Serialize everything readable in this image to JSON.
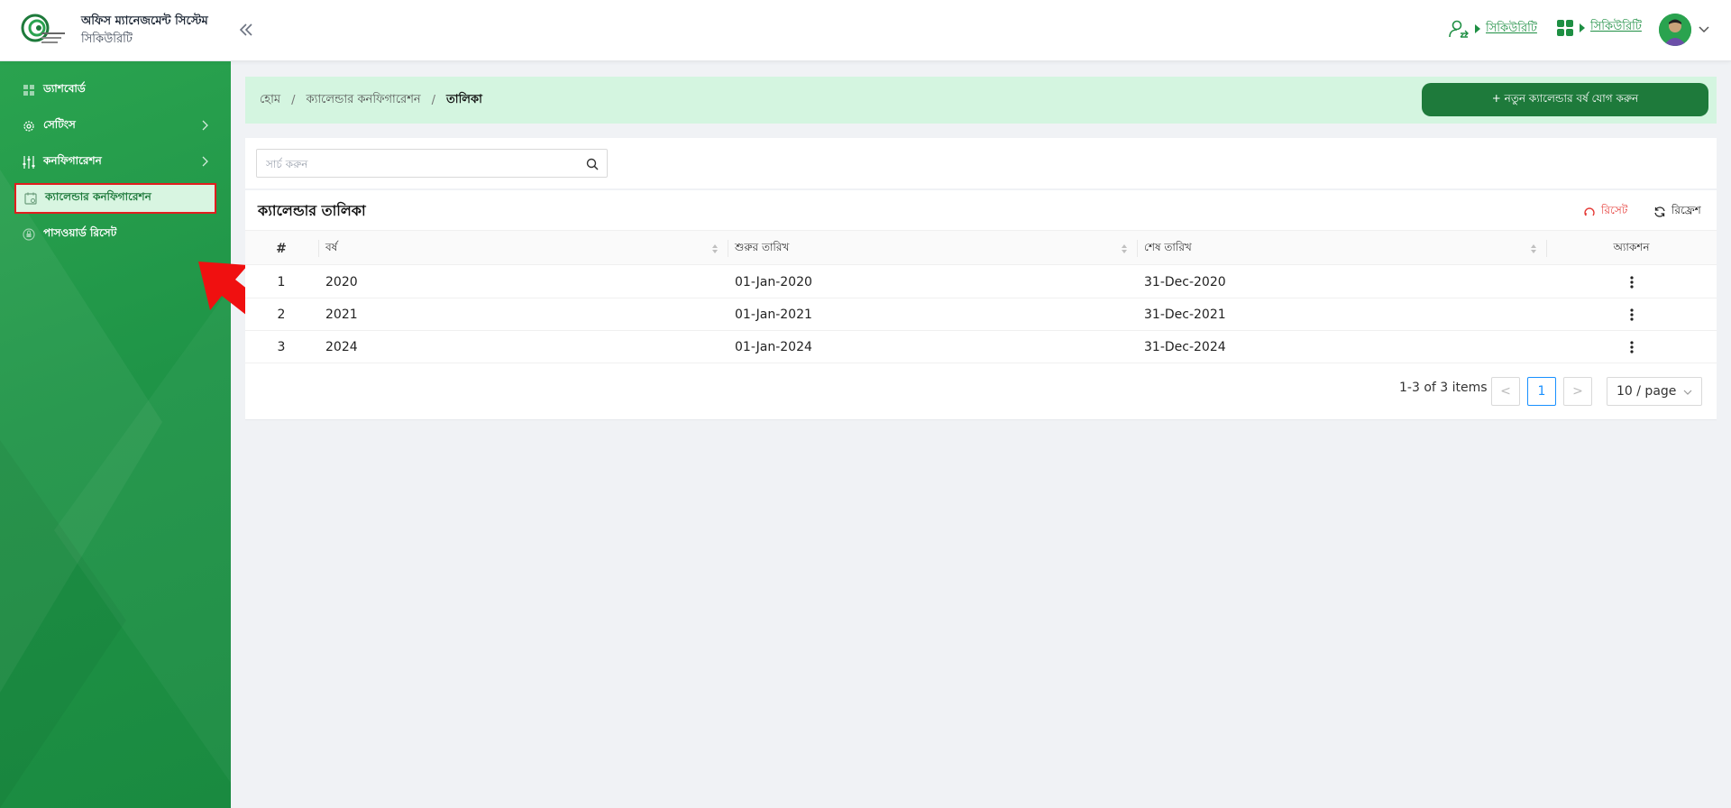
{
  "header": {
    "app_title": "অফিস ম্যানেজমেন্ট সিস্টেম",
    "app_subtitle": "সিকিউরিটি",
    "role_link": "সিকিউরিটি",
    "module_link": "সিকিউরিটি"
  },
  "sidebar": {
    "items": [
      {
        "label": "ড্যাশবোর্ড",
        "icon": "dashboard-icon"
      },
      {
        "label": "সেটিংস",
        "icon": "gear-icon"
      },
      {
        "label": "কনফিগারেশন",
        "icon": "sliders-icon"
      },
      {
        "label": "ক্যালেন্ডার কনফিগারেশন",
        "icon": "calendar-icon"
      },
      {
        "label": "পাসওয়ার্ড রিসেট",
        "icon": "password-reset-icon"
      }
    ]
  },
  "breadcrumb": {
    "home": "হোম",
    "section": "ক্যালেন্ডার কনফিগারেশন",
    "current": "তালিকা"
  },
  "add_button": "+ নতুন ক্যালেন্ডার বর্ষ যোগ করুন",
  "search": {
    "placeholder": "সার্চ করুন"
  },
  "table": {
    "title": "ক্যালেন্ডার তালিকা",
    "reset_label": "রিসেট",
    "refresh_label": "রিফ্রেশ",
    "columns": [
      "#",
      "বর্ষ",
      "শুরুর তারিখ",
      "শেষ তারিখ",
      "অ্যাকশন"
    ],
    "rows": [
      {
        "index": "1",
        "year": "2020",
        "start": "01-Jan-2020",
        "end": "31-Dec-2020"
      },
      {
        "index": "2",
        "year": "2021",
        "start": "01-Jan-2021",
        "end": "31-Dec-2021"
      },
      {
        "index": "3",
        "year": "2024",
        "start": "01-Jan-2024",
        "end": "31-Dec-2024"
      }
    ]
  },
  "pagination": {
    "total_text": "1-3 of 3 items",
    "prev": "<",
    "current_page": "1",
    "next": ">",
    "page_size": "10 / page"
  },
  "colors": {
    "brand_green": "#1e7a3b",
    "sidebar_green": "#1f9447",
    "breadcrumb_bg": "#d4f5e0",
    "reset_red": "#e53935",
    "pagination_blue": "#1890ff"
  }
}
